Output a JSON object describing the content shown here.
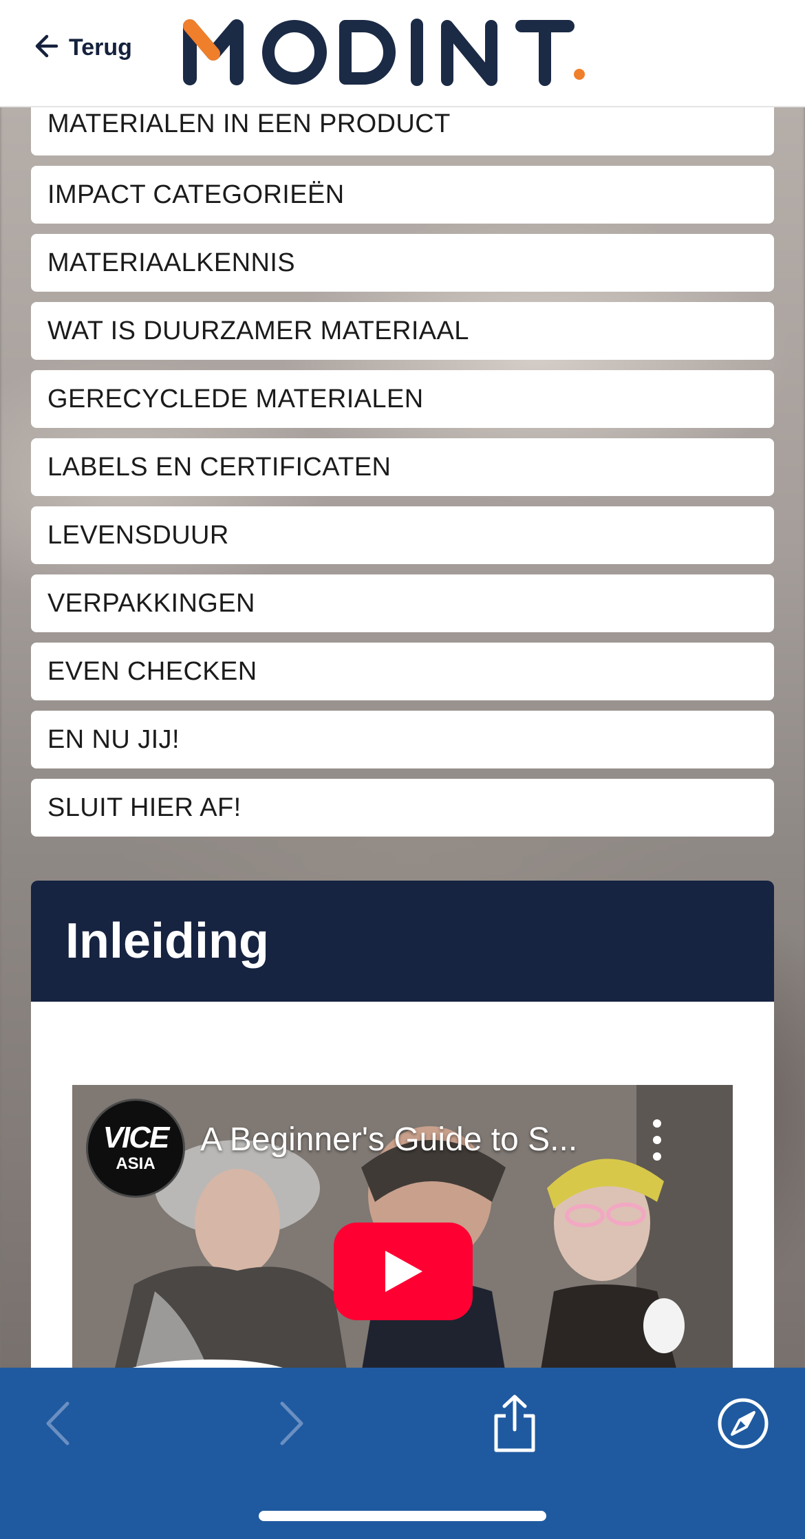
{
  "header": {
    "back_label": "Terug",
    "logo_text": "MODINT",
    "logo_colors": {
      "text": "#1b2a45",
      "accent": "#f07f2b"
    }
  },
  "menu": {
    "items": [
      "MATERIALEN IN EEN PRODUCT",
      "IMPACT CATEGORIEËN",
      "MATERIAALKENNIS",
      "WAT IS DUURZAMER MATERIAAL",
      "GERECYCLEDE MATERIALEN",
      "LABELS EN CERTIFICATEN",
      "LEVENSDUUR",
      "VERPAKKINGEN",
      "EVEN CHECKEN",
      "EN NU JIJ!",
      "SLUIT HIER AF!"
    ]
  },
  "section": {
    "title": "Inleiding",
    "header_color": "#162341"
  },
  "video": {
    "channel_logo_text": "VICE",
    "channel_logo_sub": "ASIA",
    "title": "A Beginner's Guide to S...",
    "play_color": "#ff0033"
  },
  "browser_bar": {
    "color": "#1f5aa0",
    "icons": [
      "chevron-left-icon",
      "chevron-right-icon",
      "share-icon",
      "compass-icon"
    ]
  }
}
